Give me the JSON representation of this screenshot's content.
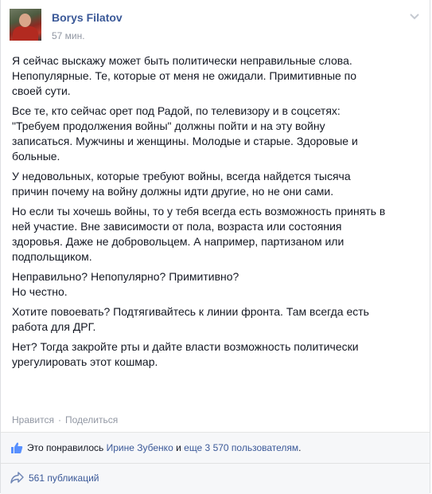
{
  "post": {
    "author": "Borys Filatov",
    "time": "57 мин.",
    "paragraphs": [
      "Я сейчас выскажу может быть политически неправильные слова.\nНепопулярные. Те, которые от меня не ожидали. Примитивные по\nсвоей сути.",
      "Все те, кто сейчас орет под Радой, по телевизору и в соцсетях:\n\"Требуем продолжения войны\" должны пойти и на эту войну\nзаписаться. Мужчины и женщины. Молодые и старые. Здоровые и\nбольные.",
      "У недовольных, которые требуют войны, всегда найдется тысяча\nпричин почему на войну должны идти другие, но не они сами.",
      "Но если ты хочешь войны, то у тебя всегда есть возможность принять в\nней участие. Вне зависимости от пола, возраста или состояния\nздоровья. Даже не добровольцем. А например, партизаном или\nподпольщиком.",
      "Неправильно? Непопулярно? Примитивно?\nНо честно.",
      "Хотите повоевать? Подтягивайтесь к линии фронта. Там всегда есть\nработа для ДРГ.",
      "Нет? Тогда закройте рты и дайте власти возможность политически\nурегулировать этот кошмар."
    ]
  },
  "actions": {
    "like": "Нравится",
    "separator": "·",
    "share": "Поделиться"
  },
  "likes": {
    "prefix": "Это понравилось",
    "name": "Ирине Зубенко",
    "conj": "и",
    "others": "еще 3 570 пользователям",
    "suffix": "."
  },
  "shares": {
    "label": "561 публикаций"
  },
  "icons": {
    "options": "chevron-down-icon",
    "like": "thumbs-up-icon",
    "share": "share-arrow-icon"
  },
  "colors": {
    "link": "#3b5998",
    "meta": "#9197a3",
    "text": "#141823",
    "ufi_bg": "#f6f7f9"
  }
}
